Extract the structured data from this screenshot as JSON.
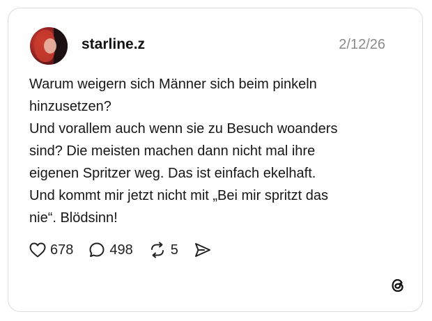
{
  "post": {
    "username": "starline.z",
    "date": "2/12/26",
    "text": "Warum weigern sich Männer sich beim pinkeln\nhinzusetzen?\nUnd vorallem auch wenn sie zu Besuch woanders\nsind? Die meisten machen dann nicht mal ihre\neigenen Spritzer weg. Das ist einfach ekelhaft.\nUnd kommt mir jetzt nicht mit „Bei mir spritzt das\nnie“. Blödsinn!"
  },
  "actions": {
    "likes": "678",
    "comments": "498",
    "reposts": "5"
  },
  "icons": {
    "like": "heart-icon",
    "comment": "speech-bubble-icon",
    "repost": "repost-icon",
    "share": "send-icon",
    "brand": "threads-logo-icon"
  }
}
